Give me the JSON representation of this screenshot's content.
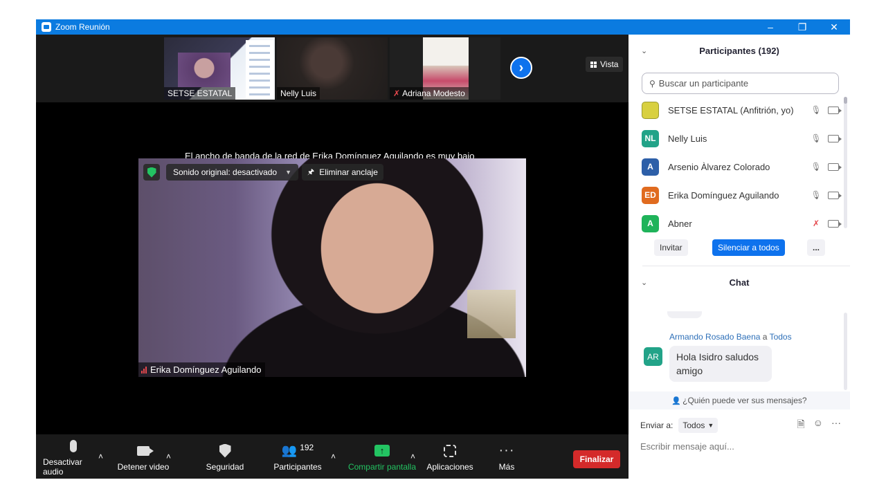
{
  "window": {
    "title": "Zoom Reunión"
  },
  "thumbnails": [
    {
      "name": "SETSE ESTATAL"
    },
    {
      "name": "Nelly Luis"
    },
    {
      "name": "Adriana Modesto"
    }
  ],
  "view_button": {
    "label": "Vista"
  },
  "bandwidth_notice": "El ancho de banda de la red de Erika Domínguez Aguilando es muy bajo",
  "main_video": {
    "original_sound": "Sonido original: desactivado",
    "unpin": "Eliminar anclaje",
    "name": "Erika Domínguez Aguilando"
  },
  "toolbar": {
    "mute": "Desactivar audio",
    "video": "Detener video",
    "security": "Seguridad",
    "participants": "Participantes",
    "participants_count": "192",
    "share": "Compartir pantalla",
    "apps": "Aplicaciones",
    "more": "Más",
    "end": "Finalizar"
  },
  "participants_panel": {
    "title": "Participantes (192)",
    "search_placeholder": "Buscar un participante",
    "items": [
      {
        "initials": "",
        "name": "SETSE ESTATAL (Anfitrión, yo)",
        "color": "#d8d040"
      },
      {
        "initials": "NL",
        "name": "Nelly Luis",
        "color": "#22a388"
      },
      {
        "initials": "A",
        "name": "Arsenio Àlvarez Colorado",
        "color": "#2d5fa8"
      },
      {
        "initials": "ED",
        "name": "Erika Domínguez Aguilando",
        "color": "#e06b1f"
      },
      {
        "initials": "A",
        "name": "Abner",
        "color": "#1fb35a"
      }
    ],
    "invite": "Invitar",
    "mute_all": "Silenciar a todos",
    "more": "..."
  },
  "chat": {
    "title": "Chat",
    "sender": "Armando Rosado Baena",
    "to_word": "a",
    "recipient": "Todos",
    "sender_initials": "AR",
    "message": "Hola Isidro saludos amigo",
    "who_can_see": "¿Quién puede ver sus mensajes?",
    "send_to_label": "Enviar a:",
    "send_to_value": "Todos",
    "input_placeholder": "Escribir mensaje aquí..."
  },
  "colors": {
    "accent": "#0e72ed",
    "danger": "#d42a2a",
    "success": "#23c462",
    "titlebar": "#0b7be0"
  }
}
